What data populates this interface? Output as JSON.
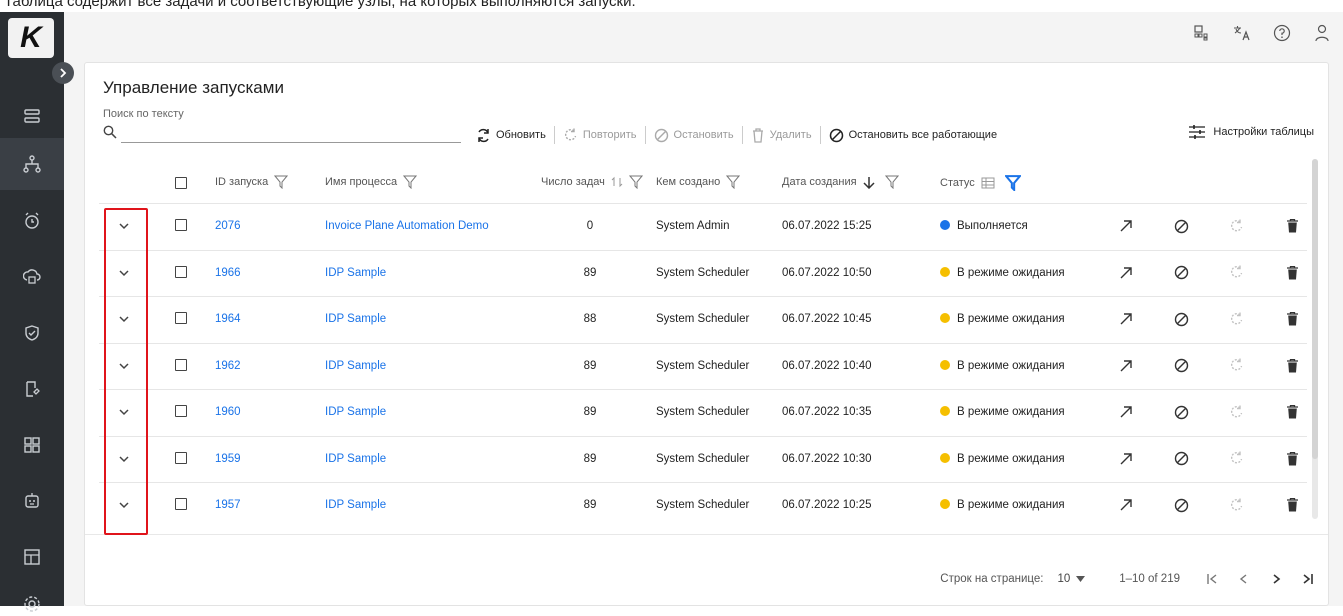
{
  "caption": "Таблица содержит все задачи и соответствующие узлы, на которых выполняются запуски.",
  "logo": "K",
  "header": {
    "title": "Управление запусками"
  },
  "search": {
    "label": "Поиск по тексту",
    "value": ""
  },
  "toolbar": {
    "refresh": "Обновить",
    "repeat": "Повторить",
    "stop": "Остановить",
    "delete": "Удалить",
    "stop_all": "Остановить все работающие",
    "table_settings": "Настройки таблицы"
  },
  "columns": {
    "id": "ID запуска",
    "process": "Имя процесса",
    "tasks": "Число задач",
    "created_by": "Кем создано",
    "created_at": "Дата создания",
    "status": "Статус"
  },
  "rows": [
    {
      "id": "2076",
      "process": "Invoice Plane Automation Demo",
      "tasks": "0",
      "created_by": "System Admin",
      "created_at": "06.07.2022 15:25",
      "status": "Выполняется",
      "status_color": "#1a73e8"
    },
    {
      "id": "1966",
      "process": "IDP Sample",
      "tasks": "89",
      "created_by": "System Scheduler",
      "created_at": "06.07.2022 10:50",
      "status": "В режиме ожидания",
      "status_color": "#f5bf00"
    },
    {
      "id": "1964",
      "process": "IDP Sample",
      "tasks": "88",
      "created_by": "System Scheduler",
      "created_at": "06.07.2022 10:45",
      "status": "В режиме ожидания",
      "status_color": "#f5bf00"
    },
    {
      "id": "1962",
      "process": "IDP Sample",
      "tasks": "89",
      "created_by": "System Scheduler",
      "created_at": "06.07.2022 10:40",
      "status": "В режиме ожидания",
      "status_color": "#f5bf00"
    },
    {
      "id": "1960",
      "process": "IDP Sample",
      "tasks": "89",
      "created_by": "System Scheduler",
      "created_at": "06.07.2022 10:35",
      "status": "В режиме ожидания",
      "status_color": "#f5bf00"
    },
    {
      "id": "1959",
      "process": "IDP Sample",
      "tasks": "89",
      "created_by": "System Scheduler",
      "created_at": "06.07.2022 10:30",
      "status": "В режиме ожидания",
      "status_color": "#f5bf00"
    },
    {
      "id": "1957",
      "process": "IDP Sample",
      "tasks": "89",
      "created_by": "System Scheduler",
      "created_at": "06.07.2022 10:25",
      "status": "В режиме ожидания",
      "status_color": "#f5bf00"
    }
  ],
  "footer": {
    "rows_per_page_label": "Строк на странице:",
    "rows_per_page_value": "10",
    "range": "1–10 of 219"
  },
  "colors": {
    "accent": "#1a73e8",
    "highlight": "#e0141b",
    "sidebar": "#2b2f33"
  }
}
